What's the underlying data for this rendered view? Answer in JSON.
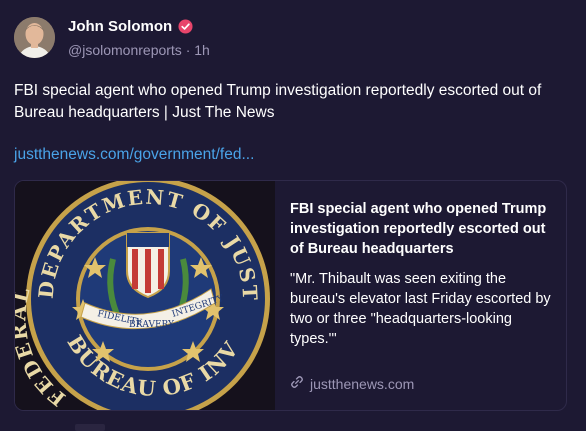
{
  "post": {
    "author_name": "John Solomon",
    "handle": "@jsolomonreports",
    "separator": "·",
    "time": "1h",
    "text": "FBI special agent who opened Trump investigation reportedly escorted out of Bureau headquarters | Just The News",
    "link_text": "justthenews.com/government/fed..."
  },
  "card": {
    "title": "FBI special agent who opened Trump investigation reportedly escorted out of Bureau headquarters",
    "description": "\"Mr. Thibault was seen exiting the bureau's elevator last Friday escorted by two or three \"headquarters-looking types.'\"",
    "source": "justthenews.com",
    "image": {
      "seal_top": "DEPARTMENT OF JUSTICE",
      "seal_left": "FEDERAL",
      "seal_bottom": "BUREAU OF INVESTIGATION",
      "banner_left": "FIDELITY",
      "banner_center": "BRAVERY",
      "banner_right": "INTEGRITY"
    }
  },
  "colors": {
    "background": "#1d1933",
    "link": "#4aa3e8",
    "muted": "#9d97b6",
    "verified_badge": "#e8456b",
    "seal_blue": "#1f3a78",
    "seal_gold": "#c6a24a"
  },
  "icons": {
    "verified": "verified-check-icon",
    "link": "link-icon"
  }
}
